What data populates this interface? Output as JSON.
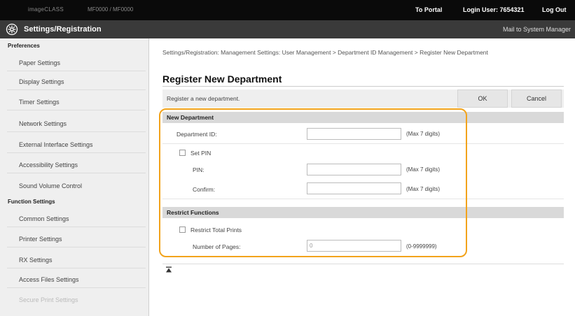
{
  "topbar": {
    "device_name": "imageCLASS",
    "device_model": "MF0000 / MF0000",
    "to_portal": "To Portal",
    "login_user": "Login User:  7654321",
    "log_out": "Log Out"
  },
  "titlebar": {
    "icon": "settings-gear-icon",
    "title": "Settings/Registration",
    "mail_link": "Mail to System Manager"
  },
  "sidebar": {
    "group1": "Preferences",
    "group1_items": [
      "Paper Settings",
      "Display Settings",
      "Timer Settings",
      "Network Settings",
      "External Interface Settings",
      "Accessibility Settings",
      "Sound Volume Control"
    ],
    "group2": "Function Settings",
    "group2_items": [
      "Common Settings",
      "Printer Settings",
      "RX Settings",
      "Access Files Settings",
      "Secure Print Settings"
    ]
  },
  "main": {
    "breadcrumb": "Settings/Registration: Management Settings: User Management > Department ID Management > Register New Department",
    "page_title": "Register New Department",
    "description": "Register a new department.",
    "ok_label": "OK",
    "cancel_label": "Cancel",
    "new_department": {
      "header": "New Department",
      "department_id_label": "Department ID:",
      "department_id_value": "",
      "department_id_hint": "(Max 7 digits)",
      "set_pin_label": "Set PIN",
      "pin_label": "PIN:",
      "pin_value": "",
      "pin_hint": "(Max 7 digits)",
      "confirm_label": "Confirm:",
      "confirm_value": "",
      "confirm_hint": "(Max 7 digits)"
    },
    "restrict_functions": {
      "header": "Restrict Functions",
      "restrict_total_prints_label": "Restrict Total Prints",
      "number_of_pages_label": "Number of Pages:",
      "number_of_pages_value": "0",
      "number_of_pages_hint": "(0-9999999)"
    }
  },
  "colors": {
    "topbar": "#0a0a0a",
    "titlebar": "#3a3a3a",
    "highlight": "#f2a31b",
    "sidebar": "#efefef"
  }
}
